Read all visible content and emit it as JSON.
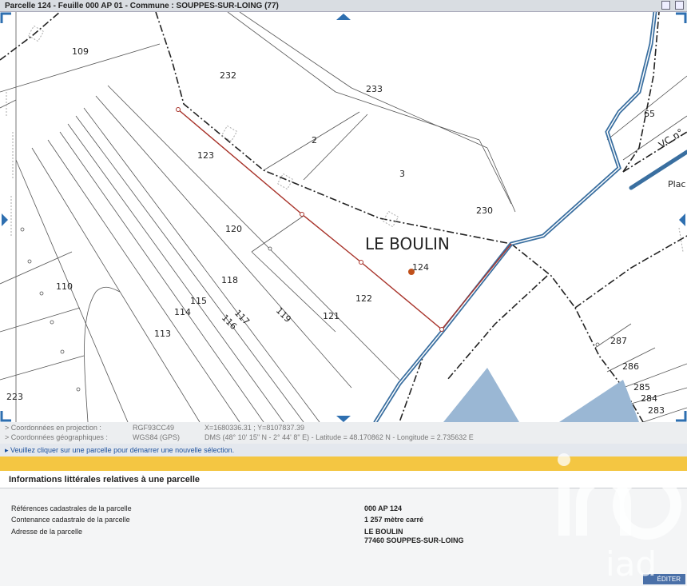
{
  "title_bar": {
    "title": "Parcelle 124 - Feuille 000 AP 01 - Commune : SOUPPES-SUR-LOING (77)"
  },
  "map": {
    "locality_label": "LE BOULIN",
    "parcels": [
      "109",
      "232",
      "233",
      "65",
      "2",
      "3",
      "123",
      "230",
      "120",
      "124",
      "118",
      "110",
      "115",
      "114",
      "116",
      "117",
      "119",
      "121",
      "122",
      "113",
      "287",
      "286",
      "285",
      "284",
      "283",
      "223",
      "Plac"
    ],
    "road_label": "VC n°"
  },
  "coordinates": {
    "projection_label": "> Coordonnées en projection :",
    "projection_system": "RGF93CC49",
    "projection_value": "X=1680336.31 ; Y=8107837.39",
    "geo_label": "> Coordonnées géographiques :",
    "geo_system": "WGS84 (GPS)",
    "geo_value": "DMS (48° 10' 15\" N - 2° 44' 8\" E) - Latitude = 48.170862 N - Longitude = 2.735632 E"
  },
  "hint": {
    "text": "▸ Veuillez cliquer sur une parcelle pour démarrer une nouvelle sélection."
  },
  "info_panel": {
    "title": "Informations littérales relatives à une parcelle",
    "rows": [
      {
        "label": "Références cadastrales de la parcelle",
        "value": "000 AP 124"
      },
      {
        "label": "Contenance cadastrale de la parcelle",
        "value": "1 257 mètre carré"
      },
      {
        "label": "Adresse de la parcelle",
        "value": "LE BOULIN"
      }
    ],
    "address_line2": "77460 SOUPPES-SUR-LOING",
    "edit_label": "ÉDITER"
  },
  "watermark": {
    "text": "iad"
  },
  "colors": {
    "accent_yellow": "#f4c642",
    "road_blue": "#3a6fa0",
    "selection_red": "#a8332a",
    "nav_arrow": "#2e6fb0"
  }
}
